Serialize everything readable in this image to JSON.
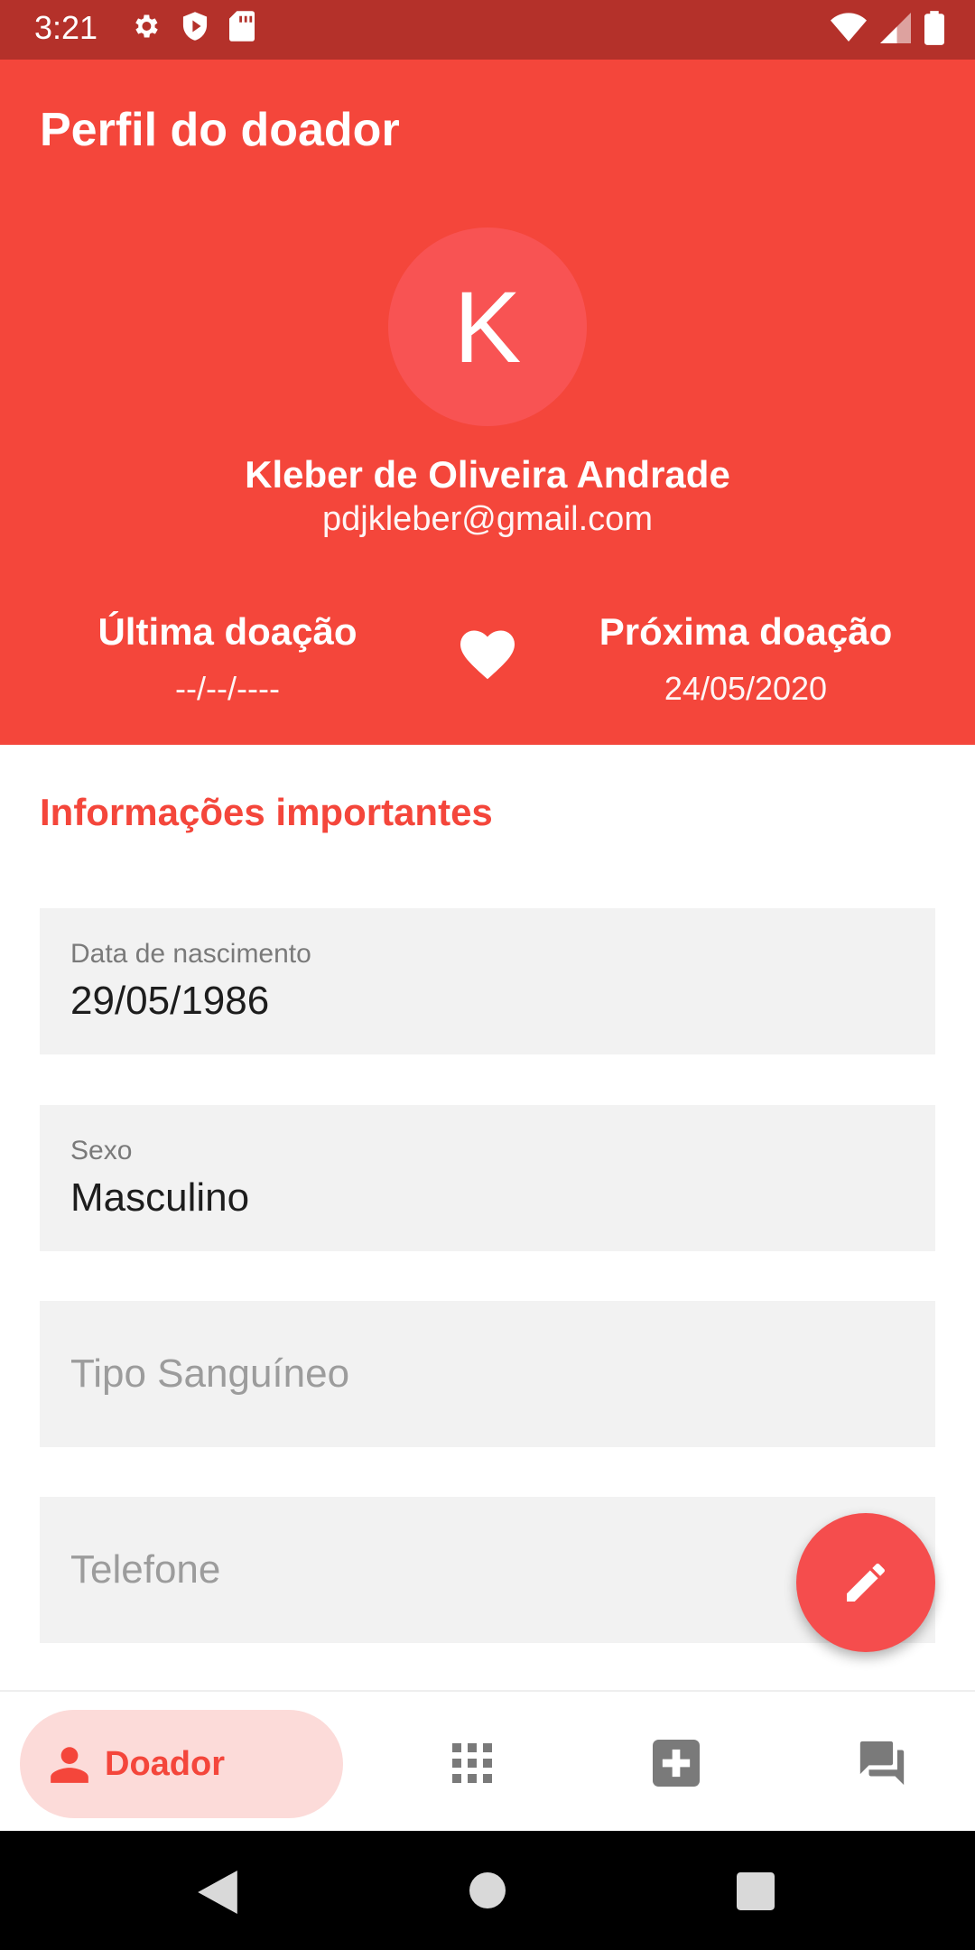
{
  "status_bar": {
    "time": "3:21",
    "left_icons": [
      "gear-icon",
      "shield-icon",
      "sd-card-icon"
    ],
    "right_icons": [
      "wifi-icon",
      "signal-icon",
      "battery-icon"
    ]
  },
  "header": {
    "title": "Perfil do doador",
    "avatar_initial": "K",
    "name": "Kleber de Oliveira Andrade",
    "email": "pdjkleber@gmail.com",
    "last_donation": {
      "label": "Última doação",
      "value": "--/--/----"
    },
    "next_donation": {
      "label": "Próxima doação",
      "value": "24/05/2020"
    },
    "heart_icon": "heart-icon"
  },
  "section": {
    "title": "Informações importantes"
  },
  "fields": {
    "birth": {
      "label": "Data de nascimento",
      "value": "29/05/1986"
    },
    "sex": {
      "label": "Sexo",
      "value": "Masculino"
    },
    "blood_type": {
      "placeholder": "Tipo Sanguíneo"
    },
    "phone": {
      "placeholder": "Telefone"
    }
  },
  "fab": {
    "icon": "pencil-edit-icon"
  },
  "bottom_nav": {
    "items": [
      {
        "label": "Doador",
        "icon": "person-icon",
        "active": true
      },
      {
        "label": "",
        "icon": "grid-icon",
        "active": false
      },
      {
        "label": "",
        "icon": "medical-cross-icon",
        "active": false
      },
      {
        "label": "",
        "icon": "chat-icon",
        "active": false
      }
    ]
  },
  "colors": {
    "status_bar": "#b4312a",
    "header": "#f4463b",
    "avatar": "#f85353",
    "accent": "#f4463b",
    "nav_active_bg": "#fcdbd9",
    "field_bg": "#f2f2f2"
  },
  "system_nav": {
    "icons": [
      "back-triangle-icon",
      "home-circle-icon",
      "recents-square-icon"
    ]
  }
}
